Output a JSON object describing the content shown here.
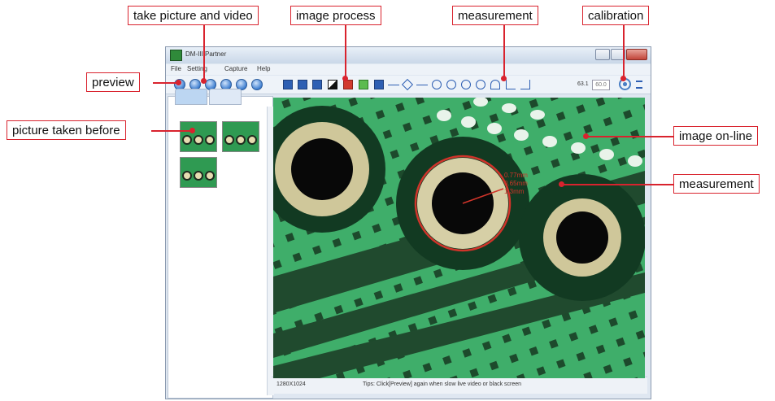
{
  "window": {
    "title": "DM-III Partner",
    "menu": [
      "File",
      "Setting",
      "Capture",
      "Help"
    ]
  },
  "toolbar": {
    "ratio_value": "63.1",
    "ratio_input": "60.0"
  },
  "viewer": {
    "measure_lines": [
      "0.77mm",
      "0.65mm",
      "1.3mm"
    ]
  },
  "status": {
    "resolution": "1280X1024",
    "tip": "Tips: Click[Preview] again when slow live video or black screen"
  },
  "callouts": {
    "take_picture": "take picture and video",
    "image_process": "image process",
    "measurement_top": "measurement",
    "calibration": "calibration",
    "preview": "preview",
    "picture_taken": "picture taken before",
    "image_online": "image on-line",
    "measurement_right": "measurement"
  },
  "colors": {
    "callout_border": "#d9232e",
    "board_green": "#3aa866",
    "measure_red": "#d0342a"
  }
}
